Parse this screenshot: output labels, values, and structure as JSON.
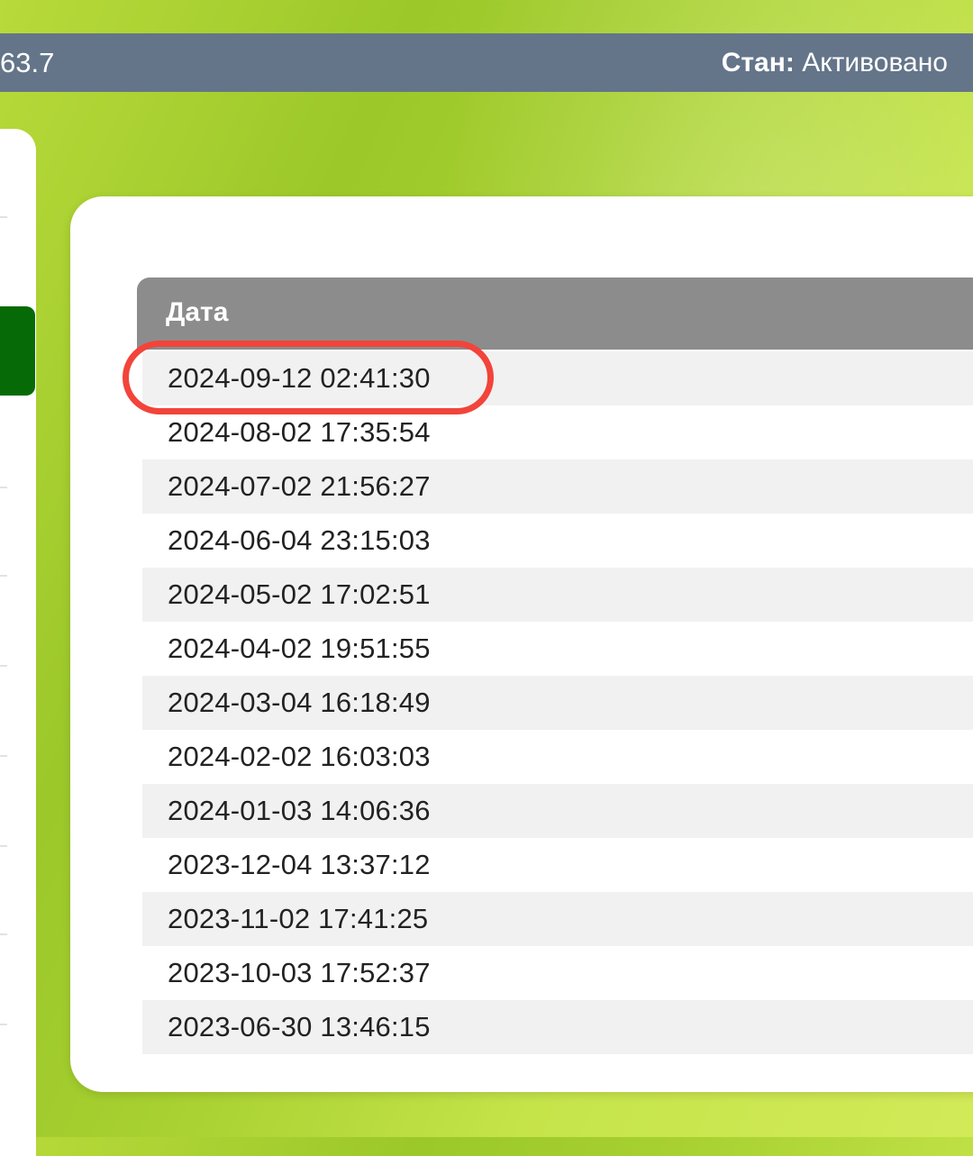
{
  "topbar": {
    "left_value": "63.7",
    "status_label": "Стан:",
    "status_value": "Активовано"
  },
  "table": {
    "header": "Дата",
    "rows": [
      "2024-09-12 02:41:30",
      "2024-08-02 17:35:54",
      "2024-07-02 21:56:27",
      "2024-06-04 23:15:03",
      "2024-05-02 17:02:51",
      "2024-04-02 19:51:55",
      "2024-03-04 16:18:49",
      "2024-02-02 16:03:03",
      "2024-01-03 14:06:36",
      "2023-12-04 13:37:12",
      "2023-11-02 17:41:25",
      "2023-10-03 17:52:37",
      "2023-06-30 13:46:15"
    ]
  },
  "colors": {
    "topbar": "#64758a",
    "header": "#8c8c8c",
    "sidebar_active": "#066b06",
    "highlight": "#f2443a"
  }
}
